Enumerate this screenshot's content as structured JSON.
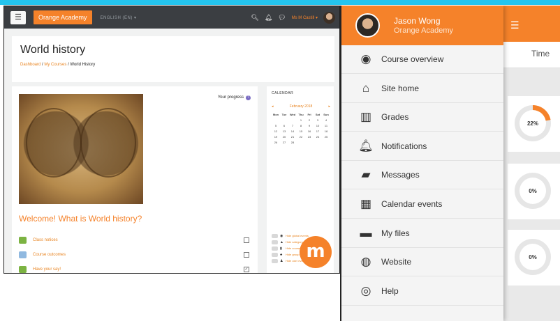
{
  "desktop": {
    "brand": "Orange Academy",
    "language": "ENGLISH (EN) ▾",
    "user_name": "Ms M Castill ▾",
    "page_title": "World history",
    "breadcrumb": {
      "dashboard": "Dashboard",
      "my_courses": "My Courses",
      "current": "World History",
      "separator": "/"
    },
    "progress_label": "Your progress",
    "welcome_heading": "Welcome! What is World history?",
    "activities": [
      {
        "label": "Class notices",
        "completed": false,
        "icon": "forum-icon",
        "color": "#7cb342"
      },
      {
        "label": "Course outcomes",
        "completed": false,
        "icon": "page-icon",
        "color": "#90b9e0"
      },
      {
        "label": "Have your say!",
        "completed": true,
        "icon": "feedback-icon",
        "color": "#7cb342"
      }
    ],
    "calendar": {
      "title": "CALENDAR",
      "month": "February 2018",
      "prev": "◂",
      "next": "▸",
      "day_headers": [
        "Mon",
        "Tue",
        "Wed",
        "Thu",
        "Fri",
        "Sat",
        "Sun"
      ],
      "days": [
        "",
        "",
        "",
        "1",
        "2",
        "3",
        "4",
        "5",
        "6",
        "7",
        "8",
        "9",
        "10",
        "11",
        "12",
        "13",
        "14",
        "15",
        "16",
        "17",
        "18",
        "19",
        "20",
        "21",
        "22",
        "23",
        "24",
        "25",
        "26",
        "27",
        "28",
        "",
        "",
        "",
        ""
      ],
      "legend": [
        {
          "label": "Hide global events",
          "icon": "globe-icon"
        },
        {
          "label": "Hide category events",
          "icon": "category-icon"
        },
        {
          "label": "Hide course events",
          "icon": "course-icon"
        },
        {
          "label": "Hide group events",
          "icon": "group-icon"
        },
        {
          "label": "Hide user events",
          "icon": "user-icon"
        }
      ]
    },
    "logo_text": "m",
    "colors": {
      "accent": "#f5822a",
      "navbar": "#3b3e42"
    }
  },
  "mobile": {
    "user_name": "Jason Wong",
    "site_name": "Orange Academy",
    "menu_items": [
      {
        "label": "Course overview",
        "icon": "course-overview-icon"
      },
      {
        "label": "Site home",
        "icon": "home-icon"
      },
      {
        "label": "Grades",
        "icon": "grades-icon"
      },
      {
        "label": "Notifications",
        "icon": "bell-icon"
      },
      {
        "label": "Messages",
        "icon": "messages-icon"
      },
      {
        "label": "Calendar events",
        "icon": "calendar-icon"
      },
      {
        "label": "My files",
        "icon": "folder-icon"
      },
      {
        "label": "Website",
        "icon": "globe-icon"
      },
      {
        "label": "Help",
        "icon": "help-icon"
      }
    ],
    "time_tab": "Time",
    "progress": [
      {
        "label": "22%",
        "value": 22
      },
      {
        "label": "0%",
        "value": 0
      },
      {
        "label": "0%",
        "value": 0
      }
    ]
  }
}
